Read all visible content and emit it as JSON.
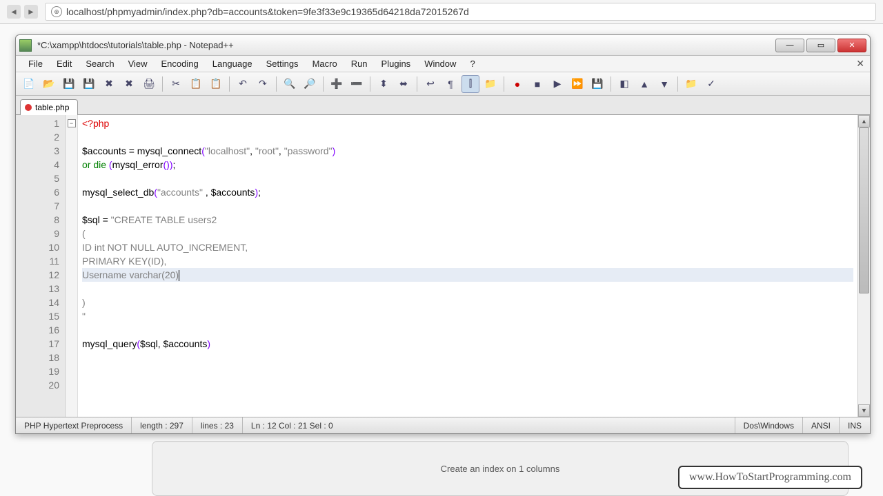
{
  "browser": {
    "url": "localhost/phpmyadmin/index.php?db=accounts&token=9fe3f33e9c19365d64218da72015267d"
  },
  "npp": {
    "title": "*C:\\xampp\\htdocs\\tutorials\\table.php - Notepad++",
    "menu": [
      "File",
      "Edit",
      "Search",
      "View",
      "Encoding",
      "Language",
      "Settings",
      "Macro",
      "Run",
      "Plugins",
      "Window",
      "?"
    ],
    "tab": "table.php",
    "status": {
      "lang": "PHP Hypertext Preprocess",
      "length": "length : 297",
      "lines": "lines : 23",
      "pos": "Ln : 12   Col : 21   Sel : 0",
      "eol": "Dos\\Windows",
      "enc": "ANSI",
      "mode": "INS"
    },
    "linecount": 20
  },
  "code": {
    "l1_tag": "<?php",
    "l3_var": "$accounts",
    "l3_op": " = ",
    "l3_fn": "mysql_connect",
    "l3_p1": "(",
    "l3_s1": "\"localhost\"",
    "l3_c1": ", ",
    "l3_s2": "\"root\"",
    "l3_c2": ", ",
    "l3_s3": "\"password\"",
    "l3_p2": ")",
    "l4_kw": "or die ",
    "l4_p1": "(",
    "l4_fn": "mysql_error",
    "l4_p2": "())",
    "l4_end": ";",
    "l6_fn": "mysql_select_db",
    "l6_p1": "(",
    "l6_s1": "\"accounts\"",
    "l6_c": " , ",
    "l6_v": "$accounts",
    "l6_p2": ")",
    "l6_end": ";",
    "l8_v": "$sql",
    "l8_op": " = ",
    "l8_s": "\"CREATE TABLE users2",
    "l9": "(",
    "l10": "ID int NOT NULL AUTO_INCREMENT,",
    "l11": "PRIMARY KEY(ID),",
    "l12": "Username varchar(20)",
    "l13": "",
    "l14": ")",
    "l15": "\"",
    "l17_fn": "mysql_query",
    "l17_p1": "(",
    "l17_v1": "$sql",
    "l17_c": ", ",
    "l17_v2": "$accounts",
    "l17_p2": ")"
  },
  "watermark": "www.HowToStartProgramming.com",
  "bottom": "Create an index on    1    columns"
}
